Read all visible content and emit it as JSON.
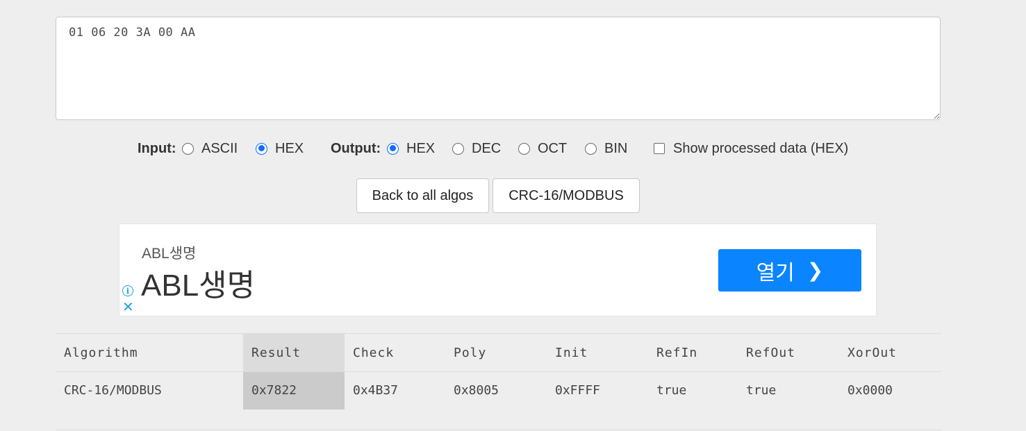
{
  "input": {
    "value": "01 06 20 3A 00 AA"
  },
  "options": {
    "input_label": "Input:",
    "input_choices": [
      {
        "label": "ASCII",
        "checked": false
      },
      {
        "label": "HEX",
        "checked": true
      }
    ],
    "output_label": "Output:",
    "output_choices": [
      {
        "label": "HEX",
        "checked": true
      },
      {
        "label": "DEC",
        "checked": false
      },
      {
        "label": "OCT",
        "checked": false
      },
      {
        "label": "BIN",
        "checked": false
      }
    ],
    "show_processed": {
      "label": "Show processed data (HEX)",
      "checked": false
    }
  },
  "buttons": {
    "back": "Back to all algos",
    "algo": "CRC-16/MODBUS"
  },
  "ad": {
    "small_title": "ABL생명",
    "big_title": "ABL생명",
    "open_label": "열기",
    "colors": {
      "button": "#0a84ff",
      "icons": "#1aa3d8"
    }
  },
  "table": {
    "headers": [
      "Algorithm",
      "Result",
      "Check",
      "Poly",
      "Init",
      "RefIn",
      "RefOut",
      "XorOut"
    ],
    "rows": [
      [
        "CRC-16/MODBUS",
        "0x7822",
        "0x4B37",
        "0x8005",
        "0xFFFF",
        "true",
        "true",
        "0x0000"
      ]
    ]
  }
}
